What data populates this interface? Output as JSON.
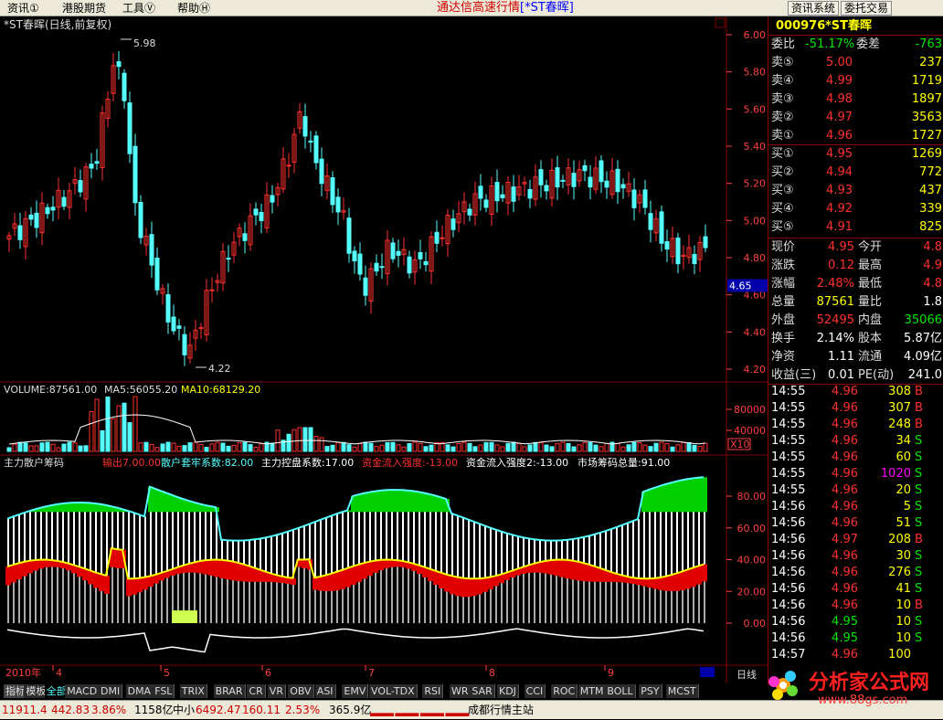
{
  "menu": {
    "items": [
      "资讯①",
      "港股期货",
      "工具Ⓥ",
      "帮助Ⓗ"
    ],
    "app_title": "通达信高速行情",
    "stock_tag": "[*ST春晖]",
    "btn_info": "资讯系统",
    "btn_trade": "委托交易"
  },
  "chart_title": "*ST春晖(日线,前复权)",
  "colors": {
    "up": "#ff3030",
    "down": "#5ff",
    "grid": "#800000",
    "axis": "#ff4040"
  },
  "price_axis": {
    "ticks": [
      "6.00",
      "5.80",
      "5.60",
      "5.40",
      "5.20",
      "5.00",
      "4.80",
      "4.60",
      "4.40",
      "4.20"
    ],
    "current": "4.65",
    "high_mark": "5.98",
    "low_mark": "4.22"
  },
  "volume": {
    "label": "VOLUME:87561.00",
    "ma5": "MA5:56055.20",
    "ma10": "MA10:68129.20",
    "ticks": [
      "80000",
      "40000"
    ],
    "unit": "X10"
  },
  "indicator": {
    "name": "主力散户筹码",
    "out": "输出7.00.00",
    "retail": "散户套牢系数:82.00",
    "control": "主力控盘系数:17.00",
    "flow": "资金流入强度:-13.00",
    "flow2": "资金流入强度2:-13.00",
    "chips": "市场筹码总量:91.00",
    "ticks": [
      "80.00",
      "60.00",
      "40.00",
      "20.00",
      "0.00"
    ]
  },
  "x_axis": {
    "year": "2010年",
    "months": [
      "4",
      "5",
      "6",
      "7",
      "8",
      "9"
    ],
    "period": "日线"
  },
  "panel": {
    "code": "000976",
    "name": "*ST春晖",
    "wei": {
      "label1": "委比",
      "v1": "-51.17%",
      "label2": "委差",
      "v2": "-763"
    },
    "sell": [
      {
        "l": "卖⑤",
        "p": "5.00",
        "v": "237"
      },
      {
        "l": "卖④",
        "p": "4.99",
        "v": "1719"
      },
      {
        "l": "卖③",
        "p": "4.98",
        "v": "1897"
      },
      {
        "l": "卖②",
        "p": "4.97",
        "v": "3563"
      },
      {
        "l": "卖①",
        "p": "4.96",
        "v": "1727"
      }
    ],
    "buy": [
      {
        "l": "买①",
        "p": "4.95",
        "v": "1269"
      },
      {
        "l": "买②",
        "p": "4.94",
        "v": "772"
      },
      {
        "l": "买③",
        "p": "4.93",
        "v": "437"
      },
      {
        "l": "买④",
        "p": "4.92",
        "v": "339"
      },
      {
        "l": "买⑤",
        "p": "4.91",
        "v": "825"
      }
    ],
    "stats": [
      {
        "a": "现价",
        "av": "4.95",
        "b": "今开",
        "bv": "4.8"
      },
      {
        "a": "涨跌",
        "av": "0.12",
        "b": "最高",
        "bv": "4.9"
      },
      {
        "a": "涨幅",
        "av": "2.48%",
        "b": "最低",
        "bv": "4.8"
      },
      {
        "a": "总量",
        "av": "87561",
        "b": "量比",
        "bv": "1.8"
      },
      {
        "a": "外盘",
        "av": "52495",
        "b": "内盘",
        "bv": "35066"
      },
      {
        "a": "换手",
        "av": "2.14%",
        "b": "股本",
        "bv": "5.87亿"
      },
      {
        "a": "净资",
        "av": "1.11",
        "b": "流通",
        "bv": "4.09亿"
      },
      {
        "a": "收益(三)",
        "av": "0.01",
        "b": "PE(动)",
        "bv": "241.0"
      }
    ],
    "ticks": [
      {
        "t": "14:55",
        "p": "4.96",
        "v": "308",
        "d": "B"
      },
      {
        "t": "14:55",
        "p": "4.96",
        "v": "307",
        "d": "B"
      },
      {
        "t": "14:55",
        "p": "4.96",
        "v": "248",
        "d": "B"
      },
      {
        "t": "14:55",
        "p": "4.96",
        "v": "34",
        "d": "S"
      },
      {
        "t": "14:55",
        "p": "4.96",
        "v": "60",
        "d": "S"
      },
      {
        "t": "14:55",
        "p": "4.96",
        "v": "1020",
        "d": "S"
      },
      {
        "t": "14:55",
        "p": "4.96",
        "v": "20",
        "d": "S"
      },
      {
        "t": "14:56",
        "p": "4.96",
        "v": "5",
        "d": "S"
      },
      {
        "t": "14:56",
        "p": "4.96",
        "v": "51",
        "d": "S"
      },
      {
        "t": "14:56",
        "p": "4.97",
        "v": "208",
        "d": "B"
      },
      {
        "t": "14:56",
        "p": "4.96",
        "v": "30",
        "d": "S"
      },
      {
        "t": "14:56",
        "p": "4.96",
        "v": "276",
        "d": "S"
      },
      {
        "t": "14:56",
        "p": "4.96",
        "v": "41",
        "d": "S"
      },
      {
        "t": "14:56",
        "p": "4.96",
        "v": "10",
        "d": "B"
      },
      {
        "t": "14:56",
        "p": "4.95",
        "v": "10",
        "d": "S"
      },
      {
        "t": "14:56",
        "p": "4.95",
        "v": "10",
        "d": "S"
      },
      {
        "t": "14:57",
        "p": "4.96",
        "v": "100",
        "d": ""
      }
    ]
  },
  "tabs": [
    "指标",
    "模板",
    "全部",
    "MACD",
    "DMI",
    "DMA",
    "FSL",
    "TRIX",
    "BRAR",
    "CR",
    "VR",
    "OBV",
    "ASI",
    "EMV",
    "VOL-TDX",
    "RSI",
    "WR",
    "SAR",
    "KDJ",
    "CCI",
    "ROC",
    "MTM",
    "BOLL",
    "PSY",
    "MCST"
  ],
  "status": {
    "idx1": "11911.4",
    "idx1b": "442.83",
    "idx1c": "3.86%",
    "amt1": "1158亿",
    "idx2name": "中小",
    "idx2": "6492.47",
    "idx2b": "160.11",
    "idx2c": "2.53%",
    "amt2": "365.9亿",
    "station": "成都行情主站"
  },
  "logo": {
    "text": "分析家公式网",
    "url": "www.88gs.com"
  }
}
